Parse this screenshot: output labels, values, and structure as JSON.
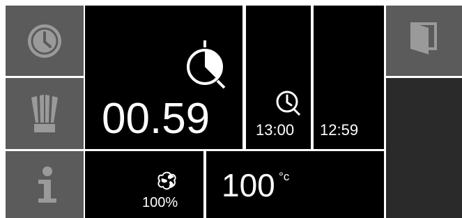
{
  "sidebar": {
    "items": [
      {
        "id": "timer",
        "icon": "clock-icon"
      },
      {
        "id": "cooking-tools",
        "icon": "chef-hat-icon"
      },
      {
        "id": "info",
        "icon": "info-icon"
      }
    ]
  },
  "main": {
    "timer_value": "00.59",
    "timer_icon": "stopwatch-icon",
    "start_time": "13:00",
    "start_icon": "clock-icon",
    "end_time": "12:59",
    "fan_icon": "fan-icon",
    "fan_speed": "100%",
    "temperature_value": "100",
    "temperature_unit": "°c"
  },
  "right_panel": {
    "door_icon": "door-icon"
  },
  "colors": {
    "button_gray": "#5b5b5b",
    "icon_gray": "#9a9a9a",
    "panel_black": "#000000",
    "panel_dark": "#2a2a2a",
    "text_white": "#ffffff"
  }
}
